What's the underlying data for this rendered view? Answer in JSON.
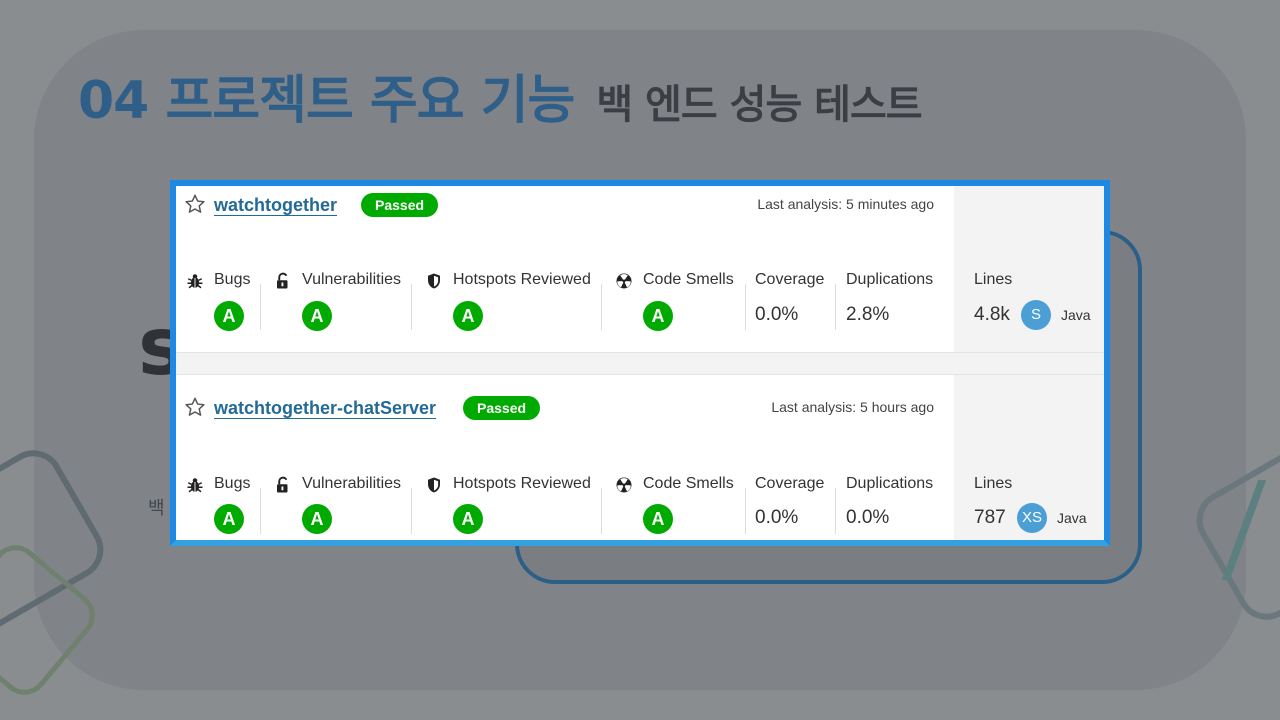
{
  "slide": {
    "title": "04 프로젝트 주요 기능",
    "subtitle": "백 엔드 성능 테스트"
  },
  "colors": {
    "accent_blue": "#1e88e5",
    "passed_green": "#00aa00",
    "link_blue": "#236a97",
    "size_blue": "#4b9fd5"
  },
  "projects": [
    {
      "name": "watchtogether",
      "status": "Passed",
      "last_analysis": "Last analysis: 5 minutes ago",
      "metrics": {
        "bugs": {
          "label": "Bugs",
          "rating": "A",
          "icon": "bug-icon"
        },
        "vulnerabilities": {
          "label": "Vulnerabilities",
          "rating": "A",
          "icon": "lock-icon"
        },
        "hotspots": {
          "label": "Hotspots Reviewed",
          "rating": "A",
          "icon": "shield-icon"
        },
        "code_smells": {
          "label": "Code Smells",
          "rating": "A",
          "icon": "radiation-icon"
        },
        "coverage": {
          "label": "Coverage",
          "value": "0.0%"
        },
        "duplications": {
          "label": "Duplications",
          "value": "2.8%"
        },
        "lines": {
          "label": "Lines",
          "value": "4.8k",
          "size": "S",
          "language": "Java"
        }
      }
    },
    {
      "name": "watchtogether-chatServer",
      "status": "Passed",
      "last_analysis": "Last analysis: 5 hours ago",
      "metrics": {
        "bugs": {
          "label": "Bugs",
          "rating": "A",
          "icon": "bug-icon"
        },
        "vulnerabilities": {
          "label": "Vulnerabilities",
          "rating": "A",
          "icon": "lock-icon"
        },
        "hotspots": {
          "label": "Hotspots Reviewed",
          "rating": "A",
          "icon": "shield-icon"
        },
        "code_smells": {
          "label": "Code Smells",
          "rating": "A",
          "icon": "radiation-icon"
        },
        "coverage": {
          "label": "Coverage",
          "value": "0.0%"
        },
        "duplications": {
          "label": "Duplications",
          "value": "0.0%"
        },
        "lines": {
          "label": "Lines",
          "value": "787",
          "size": "XS",
          "language": "Java"
        }
      }
    }
  ],
  "background_text": {
    "large_letter": "s",
    "small_text": "백"
  }
}
